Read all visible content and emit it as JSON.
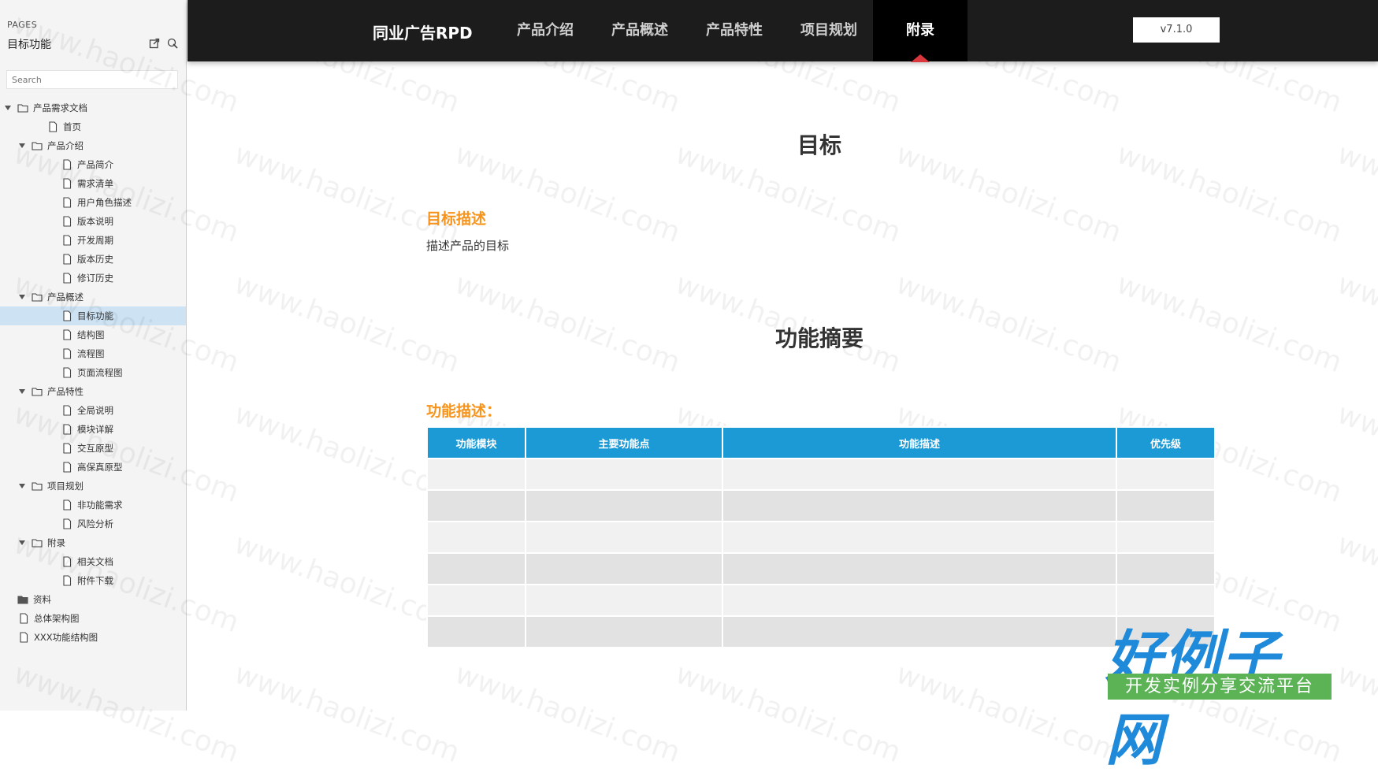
{
  "sidebar": {
    "pages_label": "PAGES",
    "current_page": "目标功能",
    "search_placeholder": "Search",
    "tree": [
      {
        "label": "产品需求文档",
        "type": "folder",
        "level": 0,
        "expanded": true
      },
      {
        "label": "首页",
        "type": "page",
        "level": 1
      },
      {
        "label": "产品介绍",
        "type": "folder",
        "level": 1,
        "expanded": true
      },
      {
        "label": "产品简介",
        "type": "page",
        "level": 2
      },
      {
        "label": "需求清单",
        "type": "page",
        "level": 2
      },
      {
        "label": "用户角色描述",
        "type": "page",
        "level": 2
      },
      {
        "label": "版本说明",
        "type": "page",
        "level": 2
      },
      {
        "label": "开发周期",
        "type": "page",
        "level": 2
      },
      {
        "label": "版本历史",
        "type": "page",
        "level": 2
      },
      {
        "label": "修订历史",
        "type": "page",
        "level": 2
      },
      {
        "label": "产品概述",
        "type": "folder",
        "level": 1,
        "expanded": true
      },
      {
        "label": "目标功能",
        "type": "page",
        "level": 2,
        "selected": true
      },
      {
        "label": "结构图",
        "type": "page",
        "level": 2
      },
      {
        "label": "流程图",
        "type": "page",
        "level": 2
      },
      {
        "label": "页面流程图",
        "type": "page",
        "level": 2
      },
      {
        "label": "产品特性",
        "type": "folder",
        "level": 1,
        "expanded": true
      },
      {
        "label": "全局说明",
        "type": "page",
        "level": 2
      },
      {
        "label": "模块详解",
        "type": "page",
        "level": 2
      },
      {
        "label": "交互原型",
        "type": "page",
        "level": 2
      },
      {
        "label": "高保真原型",
        "type": "page",
        "level": 2
      },
      {
        "label": "项目规划",
        "type": "folder",
        "level": 1,
        "expanded": true
      },
      {
        "label": "非功能需求",
        "type": "page",
        "level": 2
      },
      {
        "label": "风险分析",
        "type": "page",
        "level": 2
      },
      {
        "label": "附录",
        "type": "folder",
        "level": 1,
        "expanded": true
      },
      {
        "label": "相关文档",
        "type": "page",
        "level": 2
      },
      {
        "label": "附件下载",
        "type": "page",
        "level": 2
      },
      {
        "label": "资料",
        "type": "folder-filled",
        "level": 0
      },
      {
        "label": "总体架构图",
        "type": "page",
        "level": 0
      },
      {
        "label": "XXX功能结构图",
        "type": "page",
        "level": 0
      }
    ]
  },
  "topbar": {
    "brand": "同业广告RPD",
    "nav": [
      {
        "label": "产品介绍",
        "active": false
      },
      {
        "label": "产品概述",
        "active": false
      },
      {
        "label": "产品特性",
        "active": false
      },
      {
        "label": "项目规划",
        "active": false
      },
      {
        "label": "附录",
        "active": true
      }
    ],
    "version": "v7.1.0"
  },
  "main": {
    "section1_title": "目标",
    "goal_heading": "目标描述",
    "goal_text": "描述产品的目标",
    "section2_title": "功能摘要",
    "func_heading": "功能描述：",
    "table": {
      "headers": [
        "功能模块",
        "主要功能点",
        "功能描述",
        "优先级"
      ],
      "row_count": 6
    }
  },
  "watermark_text": "www.haolizi.com",
  "logo": {
    "main": "好例子网",
    "sub": "开发实例分享交流平台"
  },
  "colors": {
    "accent_orange": "#f7941d",
    "table_header": "#1b9ad6",
    "nav_bg": "#1c1c1c",
    "active_caret": "#d9363e",
    "logo_blue": "#1f8ad9",
    "logo_green": "#5bb356"
  }
}
